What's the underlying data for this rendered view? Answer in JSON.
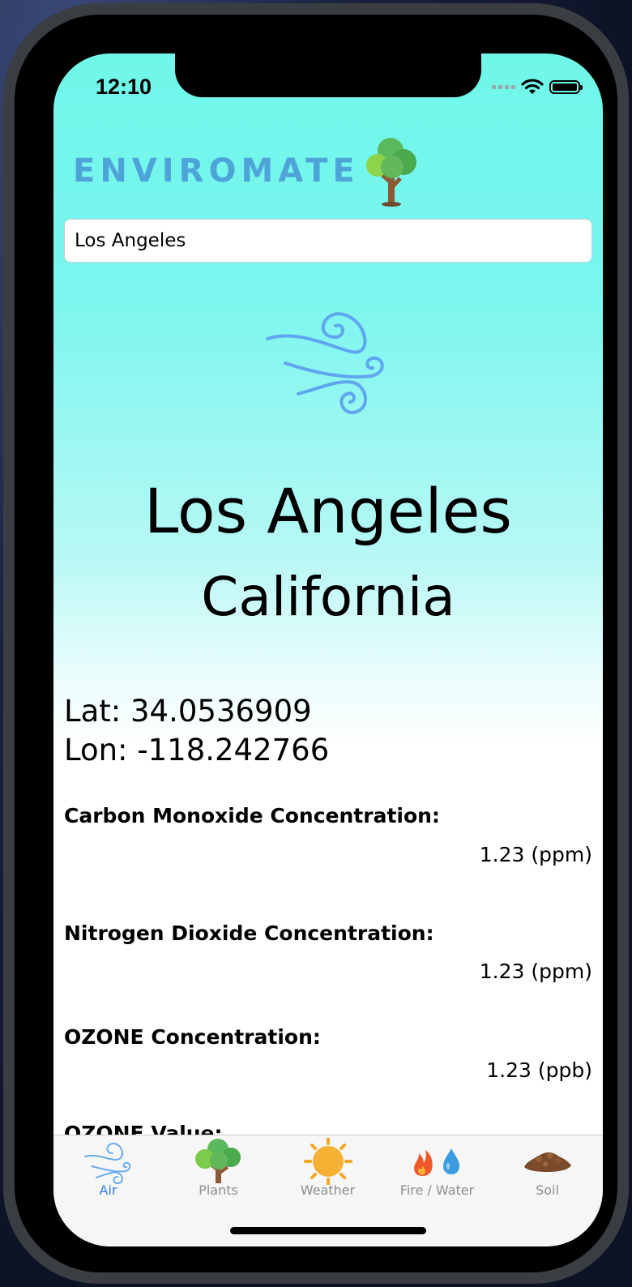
{
  "status": {
    "time": "12:10"
  },
  "app": {
    "name": "ENVIROMATE"
  },
  "search": {
    "value": "Los Angeles",
    "placeholder": ""
  },
  "location": {
    "city": "Los Angeles",
    "state": "California",
    "lat": "Lat: 34.0536909",
    "lon": "Lon: -118.242766"
  },
  "measurements": [
    {
      "label": "Carbon Monoxide Concentration:",
      "value": "1.23 (ppm)"
    },
    {
      "label": "Nitrogen Dioxide Concentration:",
      "value": "1.23 (ppm)"
    },
    {
      "label": "OZONE Concentration:",
      "value": "1.23 (ppb)"
    },
    {
      "label": "OZONE Value:",
      "value": ""
    }
  ],
  "tabs": [
    {
      "label": "Air",
      "icon": "wind-icon",
      "active": true
    },
    {
      "label": "Plants",
      "icon": "tree-icon",
      "active": false
    },
    {
      "label": "Weather",
      "icon": "sun-icon",
      "active": false
    },
    {
      "label": "Fire / Water",
      "icon": "fire-water-icon",
      "active": false
    },
    {
      "label": "Soil",
      "icon": "soil-icon",
      "active": false
    }
  ],
  "colors": {
    "gradient_top": "#6ff7ea",
    "gradient_bottom": "#ffffff",
    "logo": "#4ea4d8",
    "wind": "#5fa6ee",
    "tab_active": "#2f7fe8",
    "tab_inactive": "#8e8e93"
  }
}
